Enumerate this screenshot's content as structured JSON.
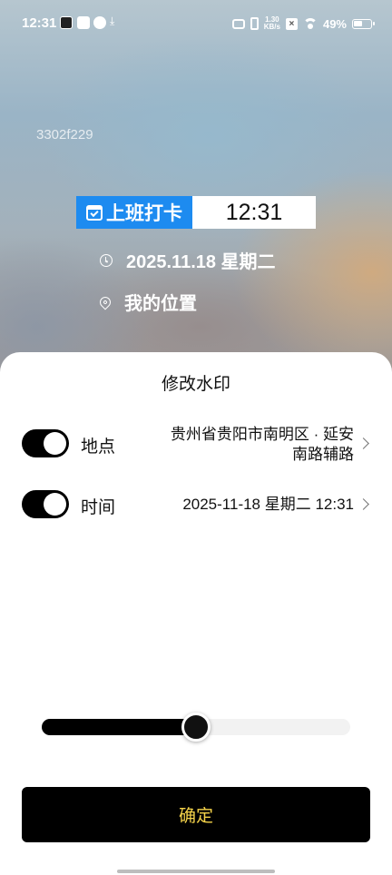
{
  "status_bar": {
    "time": "12:31",
    "net_speed_value": "1.30",
    "net_speed_unit": "KB/s",
    "battery": "49%",
    "icons": [
      "app-notification-icon",
      "message-icon",
      "check-icon",
      "download-icon",
      "camera-icon",
      "vibrate-icon",
      "sim-icon",
      "wifi-icon",
      "battery-icon"
    ]
  },
  "watermark": {
    "device_code": "3302f229",
    "punch_label": "上班打卡",
    "punch_time": "12:31",
    "date": "2025.11.18 星期二",
    "location": "我的位置"
  },
  "sheet": {
    "title": "修改水印",
    "rows": [
      {
        "label": "地点",
        "enabled": true,
        "value_line1": "贵州省贵阳市南明区 · 延安",
        "value_line2": "南路辅路"
      },
      {
        "label": "时间",
        "enabled": true,
        "value_line1": "2025-11-18 星期二 12:31"
      }
    ],
    "slider_value": 0.5,
    "confirm_label": "确定",
    "colors": {
      "confirm_text": "#f5d34a",
      "punch_label_bg": "#1d8bf0"
    }
  }
}
